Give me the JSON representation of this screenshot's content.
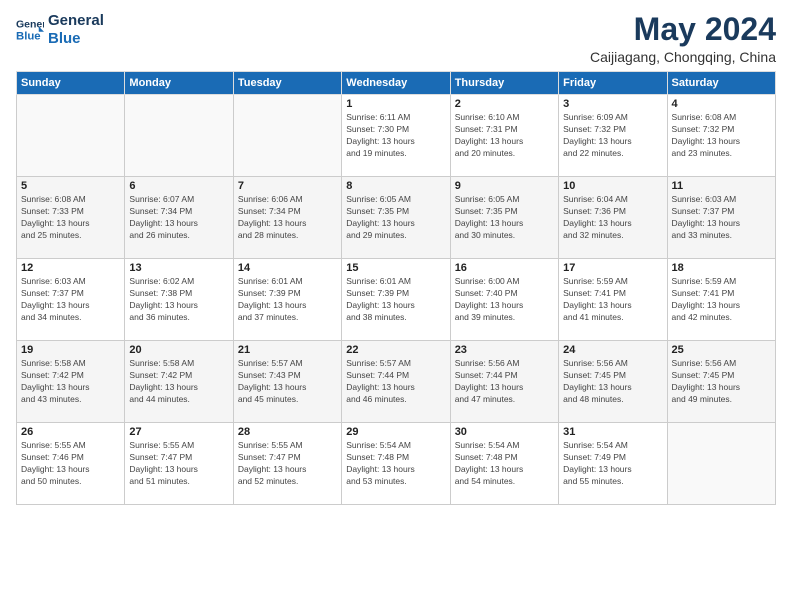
{
  "header": {
    "logo_line1": "General",
    "logo_line2": "Blue",
    "month": "May 2024",
    "location": "Caijiagang, Chongqing, China"
  },
  "weekdays": [
    "Sunday",
    "Monday",
    "Tuesday",
    "Wednesday",
    "Thursday",
    "Friday",
    "Saturday"
  ],
  "weeks": [
    [
      {
        "day": "",
        "info": ""
      },
      {
        "day": "",
        "info": ""
      },
      {
        "day": "",
        "info": ""
      },
      {
        "day": "1",
        "info": "Sunrise: 6:11 AM\nSunset: 7:30 PM\nDaylight: 13 hours\nand 19 minutes."
      },
      {
        "day": "2",
        "info": "Sunrise: 6:10 AM\nSunset: 7:31 PM\nDaylight: 13 hours\nand 20 minutes."
      },
      {
        "day": "3",
        "info": "Sunrise: 6:09 AM\nSunset: 7:32 PM\nDaylight: 13 hours\nand 22 minutes."
      },
      {
        "day": "4",
        "info": "Sunrise: 6:08 AM\nSunset: 7:32 PM\nDaylight: 13 hours\nand 23 minutes."
      }
    ],
    [
      {
        "day": "5",
        "info": "Sunrise: 6:08 AM\nSunset: 7:33 PM\nDaylight: 13 hours\nand 25 minutes."
      },
      {
        "day": "6",
        "info": "Sunrise: 6:07 AM\nSunset: 7:34 PM\nDaylight: 13 hours\nand 26 minutes."
      },
      {
        "day": "7",
        "info": "Sunrise: 6:06 AM\nSunset: 7:34 PM\nDaylight: 13 hours\nand 28 minutes."
      },
      {
        "day": "8",
        "info": "Sunrise: 6:05 AM\nSunset: 7:35 PM\nDaylight: 13 hours\nand 29 minutes."
      },
      {
        "day": "9",
        "info": "Sunrise: 6:05 AM\nSunset: 7:35 PM\nDaylight: 13 hours\nand 30 minutes."
      },
      {
        "day": "10",
        "info": "Sunrise: 6:04 AM\nSunset: 7:36 PM\nDaylight: 13 hours\nand 32 minutes."
      },
      {
        "day": "11",
        "info": "Sunrise: 6:03 AM\nSunset: 7:37 PM\nDaylight: 13 hours\nand 33 minutes."
      }
    ],
    [
      {
        "day": "12",
        "info": "Sunrise: 6:03 AM\nSunset: 7:37 PM\nDaylight: 13 hours\nand 34 minutes."
      },
      {
        "day": "13",
        "info": "Sunrise: 6:02 AM\nSunset: 7:38 PM\nDaylight: 13 hours\nand 36 minutes."
      },
      {
        "day": "14",
        "info": "Sunrise: 6:01 AM\nSunset: 7:39 PM\nDaylight: 13 hours\nand 37 minutes."
      },
      {
        "day": "15",
        "info": "Sunrise: 6:01 AM\nSunset: 7:39 PM\nDaylight: 13 hours\nand 38 minutes."
      },
      {
        "day": "16",
        "info": "Sunrise: 6:00 AM\nSunset: 7:40 PM\nDaylight: 13 hours\nand 39 minutes."
      },
      {
        "day": "17",
        "info": "Sunrise: 5:59 AM\nSunset: 7:41 PM\nDaylight: 13 hours\nand 41 minutes."
      },
      {
        "day": "18",
        "info": "Sunrise: 5:59 AM\nSunset: 7:41 PM\nDaylight: 13 hours\nand 42 minutes."
      }
    ],
    [
      {
        "day": "19",
        "info": "Sunrise: 5:58 AM\nSunset: 7:42 PM\nDaylight: 13 hours\nand 43 minutes."
      },
      {
        "day": "20",
        "info": "Sunrise: 5:58 AM\nSunset: 7:42 PM\nDaylight: 13 hours\nand 44 minutes."
      },
      {
        "day": "21",
        "info": "Sunrise: 5:57 AM\nSunset: 7:43 PM\nDaylight: 13 hours\nand 45 minutes."
      },
      {
        "day": "22",
        "info": "Sunrise: 5:57 AM\nSunset: 7:44 PM\nDaylight: 13 hours\nand 46 minutes."
      },
      {
        "day": "23",
        "info": "Sunrise: 5:56 AM\nSunset: 7:44 PM\nDaylight: 13 hours\nand 47 minutes."
      },
      {
        "day": "24",
        "info": "Sunrise: 5:56 AM\nSunset: 7:45 PM\nDaylight: 13 hours\nand 48 minutes."
      },
      {
        "day": "25",
        "info": "Sunrise: 5:56 AM\nSunset: 7:45 PM\nDaylight: 13 hours\nand 49 minutes."
      }
    ],
    [
      {
        "day": "26",
        "info": "Sunrise: 5:55 AM\nSunset: 7:46 PM\nDaylight: 13 hours\nand 50 minutes."
      },
      {
        "day": "27",
        "info": "Sunrise: 5:55 AM\nSunset: 7:47 PM\nDaylight: 13 hours\nand 51 minutes."
      },
      {
        "day": "28",
        "info": "Sunrise: 5:55 AM\nSunset: 7:47 PM\nDaylight: 13 hours\nand 52 minutes."
      },
      {
        "day": "29",
        "info": "Sunrise: 5:54 AM\nSunset: 7:48 PM\nDaylight: 13 hours\nand 53 minutes."
      },
      {
        "day": "30",
        "info": "Sunrise: 5:54 AM\nSunset: 7:48 PM\nDaylight: 13 hours\nand 54 minutes."
      },
      {
        "day": "31",
        "info": "Sunrise: 5:54 AM\nSunset: 7:49 PM\nDaylight: 13 hours\nand 55 minutes."
      },
      {
        "day": "",
        "info": ""
      }
    ]
  ]
}
